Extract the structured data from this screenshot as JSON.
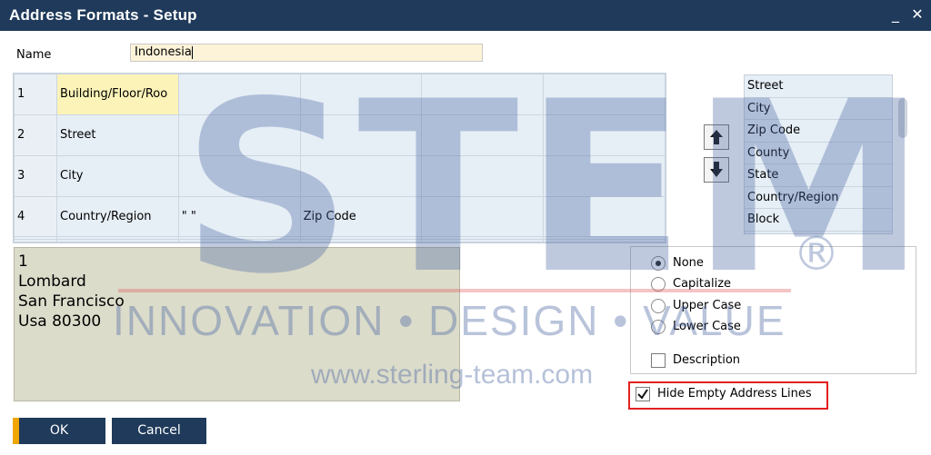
{
  "window": {
    "title": "Address Formats - Setup",
    "minimize": "_",
    "close": "✕"
  },
  "name": {
    "label": "Name",
    "value": "Indonesia"
  },
  "grid": {
    "rows": [
      {
        "num": "1",
        "cells": [
          "Building/Floor/Roo",
          "",
          "",
          "",
          ""
        ]
      },
      {
        "num": "2",
        "cells": [
          "Street",
          "",
          "",
          "",
          ""
        ]
      },
      {
        "num": "3",
        "cells": [
          "City",
          "",
          "",
          "",
          ""
        ]
      },
      {
        "num": "4",
        "cells": [
          "Country/Region",
          "\" \"",
          "Zip Code",
          "",
          ""
        ]
      },
      {
        "num": "",
        "cells": [
          "",
          "",
          "",
          "",
          ""
        ]
      },
      {
        "num": "",
        "cells": [
          "",
          "",
          "",
          "",
          ""
        ]
      }
    ]
  },
  "fields": [
    "Street",
    "City",
    "Zip Code",
    "County",
    "State",
    "Country/Region",
    "Block"
  ],
  "icons": {
    "move_up": "arrow-up-icon",
    "move_down": "arrow-down-icon"
  },
  "preview": {
    "lines": [
      "1",
      "Lombard",
      "San Francisco",
      "Usa 80300"
    ]
  },
  "options": {
    "radios": [
      {
        "label": "None",
        "selected": true
      },
      {
        "label": "Capitalize",
        "selected": false
      },
      {
        "label": "Upper Case",
        "selected": false
      },
      {
        "label": "Lower Case",
        "selected": false
      }
    ],
    "description": {
      "label": "Description",
      "checked": false
    },
    "hide_empty": {
      "label": "Hide Empty Address Lines",
      "checked": true
    }
  },
  "buttons": {
    "ok": "OK",
    "cancel": "Cancel"
  },
  "watermark": {
    "brand": "STEM",
    "reg": "®",
    "tagline": "INNOVATION • DESIGN • VALUE",
    "url": "www.sterling-team.com"
  },
  "colors": {
    "titlebar": "#1f3a5a",
    "accent": "#f0a500",
    "highlight": "#e32020"
  }
}
